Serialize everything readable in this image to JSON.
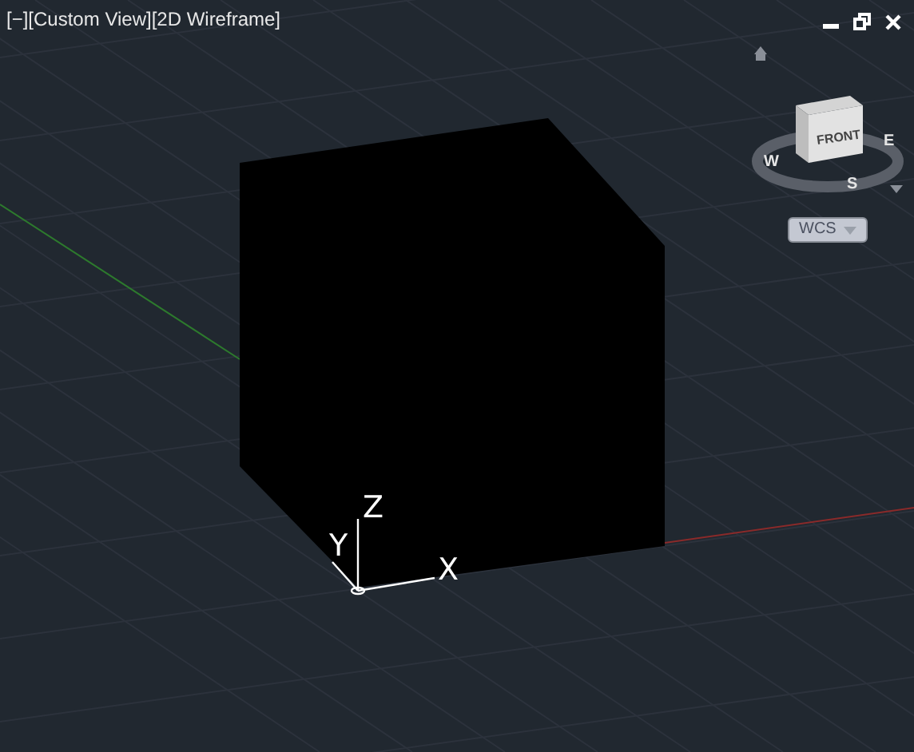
{
  "viewport_label": "[−][Custom View][2D Wireframe]",
  "viewcube": {
    "face": "FRONT",
    "compass": [
      {
        "label": "W",
        "kind": "west"
      },
      {
        "label": "S",
        "kind": "south"
      },
      {
        "label": "E",
        "kind": "east"
      }
    ]
  },
  "ucs_menu": {
    "label": "WCS"
  },
  "ucs_icon": {
    "x": "X",
    "y": "Y",
    "z": "Z"
  }
}
